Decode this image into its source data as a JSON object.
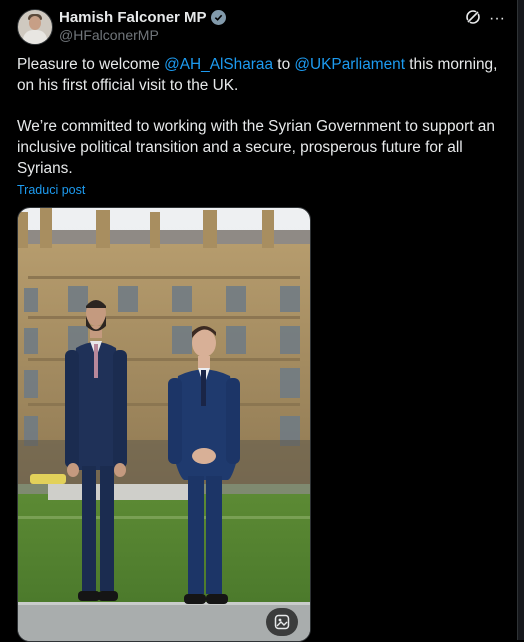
{
  "post": {
    "author_name": "Hamish Falconer MP",
    "author_handle": "@HFalconerMP",
    "text_prefix": "Pleasure to welcome ",
    "mention_1": "@AH_AlSharaa",
    "text_middle": " to ",
    "mention_2": "@UKParliament",
    "text_suffix": " this morning, on his first official visit to the UK.\n\nWe’re committed to working with the Syrian Government to support an inclusive political transition and a secure, prosperous future for all Syrians.",
    "translate_label": "Traduci post",
    "more_label": "···"
  },
  "icons": {
    "verified": "verified-badge-icon",
    "grok": "grok-icon",
    "more": "more-icon",
    "alt_text": "image-description-icon"
  },
  "colors": {
    "background": "#000000",
    "text": "#e7e9ea",
    "secondary": "#71767b",
    "link": "#1d9bf0",
    "verified": "#829aab"
  }
}
